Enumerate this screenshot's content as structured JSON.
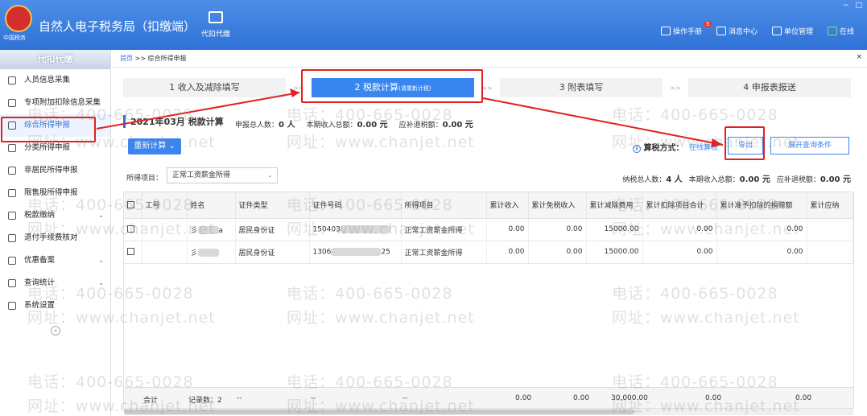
{
  "app": {
    "title": "自然人电子税务局（扣缴端）",
    "logo_sub": "中国税务",
    "top_nav_label": "代扣代缴",
    "menu": [
      "操作手册",
      "消息中心",
      "单位管理",
      "在线"
    ],
    "message_badge": "5",
    "window_controls": [
      "−",
      "□"
    ]
  },
  "sidebar": {
    "header": "代扣代缴",
    "items": [
      {
        "label": "人员信息采集",
        "icon": "person-icon",
        "chevron": false
      },
      {
        "label": "专项附加扣除信息采集",
        "icon": "list-icon",
        "chevron": false
      },
      {
        "label": "综合所得申报",
        "icon": "layers-icon",
        "chevron": false,
        "active": true
      },
      {
        "label": "分类所得申报",
        "icon": "clock-icon",
        "chevron": false
      },
      {
        "label": "非居民所得申报",
        "icon": "person-icon",
        "chevron": false
      },
      {
        "label": "限售股所得申报",
        "icon": "bar-chart-icon",
        "chevron": false
      },
      {
        "label": "税款缴纳",
        "icon": "folder-icon",
        "chevron": true
      },
      {
        "label": "退付手续费核对",
        "icon": "document-icon",
        "chevron": false
      },
      {
        "label": "优惠备案",
        "icon": "file-icon",
        "chevron": true
      },
      {
        "label": "查询统计",
        "icon": "search-icon",
        "chevron": true
      },
      {
        "label": "系统设置",
        "icon": "gear-icon",
        "chevron": false
      }
    ],
    "collapse_glyph": "«"
  },
  "breadcrumb": {
    "home": "首页",
    "sep": ">>",
    "current": "综合所得申报"
  },
  "steps": [
    {
      "label": "1 收入及减除填写"
    },
    {
      "label": "2 税款计算",
      "sub": "(请重新计税)",
      "active": true
    },
    {
      "label": "3 附表填写"
    },
    {
      "label": "4 申报表报送"
    }
  ],
  "step_arrow": ">>",
  "calc": {
    "period": "2021年03月",
    "title": "税款计算",
    "total_people_label": "申报总人数：",
    "total_people": "0 人",
    "income_label": "本期收入总额：",
    "income": "0.00 元",
    "refund_label": "应补退税额：",
    "refund": "0.00 元"
  },
  "toolbar": {
    "recalc": "重新计算 ⌄",
    "method_label": "算税方式：",
    "method_link": "在线算税",
    "export": "导出",
    "expand": "展开查询条件"
  },
  "filter": {
    "label": "所得项目：",
    "value": "正常工资薪金所得"
  },
  "summary": {
    "taxpayers_label": "纳税总人数：",
    "taxpayers": "4 人",
    "income_label": "本期收入总额：",
    "income": "0.00 元",
    "refund_label": "应补退税额：",
    "refund": "0.00 元"
  },
  "table": {
    "headers": [
      "工号",
      "姓名",
      "证件类型",
      "证件号码",
      "所得项目",
      "累计收入",
      "累计免税收入",
      "累计减除费用",
      "累计扣除项目合计",
      "累计准予扣除的捐赠额",
      "累计应纳"
    ],
    "rows": [
      {
        "emp_id": "",
        "name": "彡",
        "name_tail": "a",
        "id_type": "居民身份证",
        "id_no": "150403",
        "id_no_tail": "",
        "income_item": "正常工资薪金所得",
        "cum_income": "0.00",
        "cum_exempt": "0.00",
        "cum_deduct": "15000.00",
        "cum_items": "0.00",
        "cum_donation": "0.00"
      },
      {
        "emp_id": "",
        "name": "彡",
        "name_tail": "",
        "id_type": "居民身份证",
        "id_no": "1306",
        "id_no_tail": "25",
        "income_item": "正常工资薪金所得",
        "cum_income": "0.00",
        "cum_exempt": "0.00",
        "cum_deduct": "15000.00",
        "cum_items": "0.00",
        "cum_donation": "0.00"
      }
    ],
    "footer": {
      "label": "合计",
      "count": "记录数：2",
      "dash": "--",
      "cum_income": "0.00",
      "cum_exempt": "0.00",
      "cum_deduct": "30,000.00",
      "cum_items": "0.00",
      "cum_donation": "0.00"
    }
  },
  "watermark": {
    "phone": "电话：400-665-0028",
    "site": "网址：www.chanjet.net"
  },
  "colors": {
    "primary": "#3a86f0",
    "highlight": "#e02020",
    "header": "#2f72d6"
  }
}
